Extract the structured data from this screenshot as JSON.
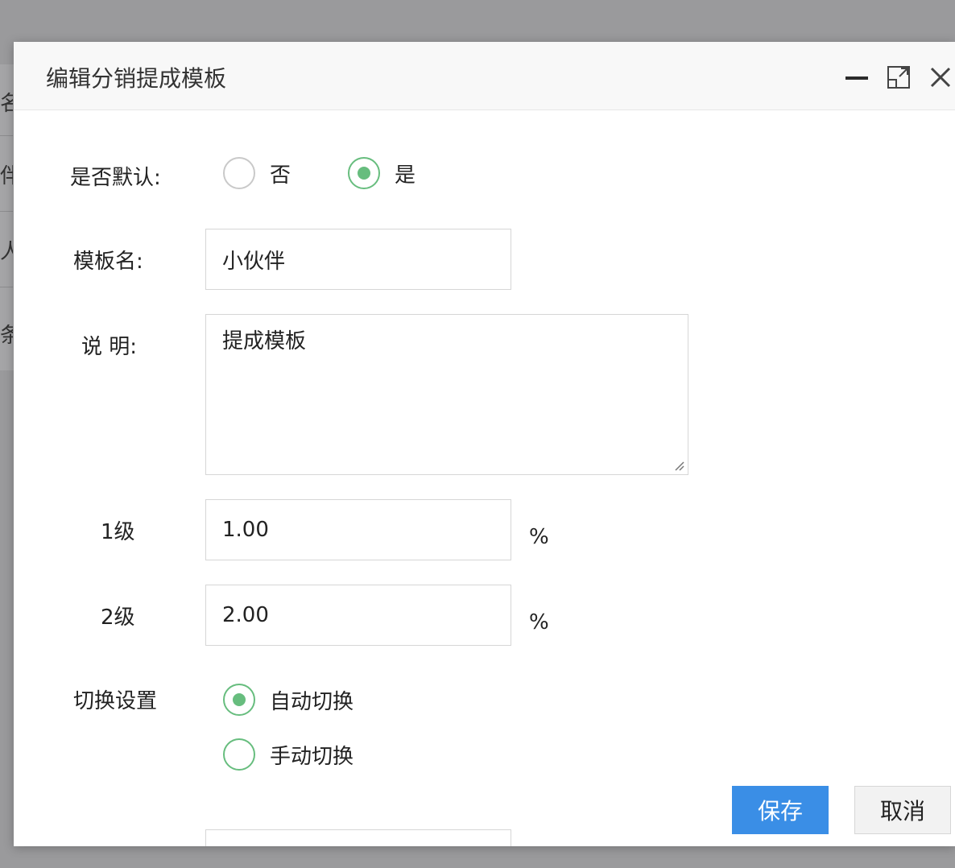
{
  "background": {
    "rows": [
      "名",
      "伴",
      "人",
      "条"
    ]
  },
  "dialog": {
    "title": "编辑分销提成模板",
    "controls": {
      "minimize_icon": "minimize-icon",
      "maximize_icon": "maximize-icon",
      "close_icon": "close-icon"
    }
  },
  "form": {
    "default": {
      "label": "是否默认:",
      "options": [
        {
          "label": "否",
          "checked": false
        },
        {
          "label": "是",
          "checked": true
        }
      ]
    },
    "template_name": {
      "label": "模板名:",
      "value": "小伙伴"
    },
    "description": {
      "label": "说 明:",
      "value": "提成模板"
    },
    "level1": {
      "label": "1级",
      "value": "1.00",
      "unit": "%"
    },
    "level2": {
      "label": "2级",
      "value": "2.00",
      "unit": "%"
    },
    "switch_setting": {
      "label": "切换设置",
      "options": [
        {
          "label": "自动切换",
          "checked": true
        },
        {
          "label": "手动切换",
          "checked": false
        }
      ]
    }
  },
  "actions": {
    "save": "保存",
    "cancel": "取消"
  },
  "colors": {
    "accent_green": "#67bd7e",
    "primary_blue": "#3a8ee6",
    "overlay": "#9a9a9c"
  }
}
